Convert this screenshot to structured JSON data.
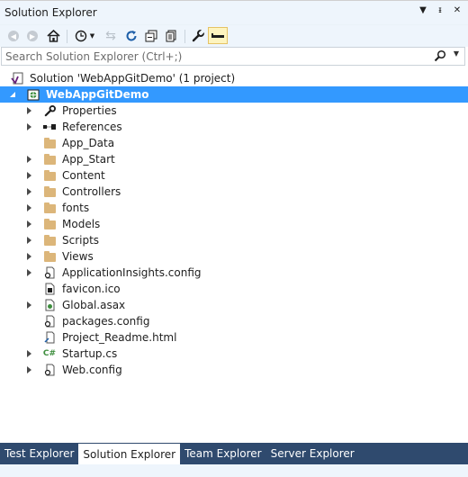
{
  "window": {
    "title": "Solution Explorer",
    "dropdown_icon": "chevron-down-icon",
    "pin_icon": "pin-icon",
    "close_icon": "close-icon"
  },
  "toolbar": {
    "buttons": [
      "back",
      "forward",
      "home",
      "pending-changes",
      "sync",
      "refresh",
      "collapse-all",
      "show-all-files",
      "properties",
      "preview"
    ]
  },
  "search": {
    "placeholder": "Search Solution Explorer (Ctrl+;)"
  },
  "tree": {
    "solution": "Solution 'WebAppGitDemo' (1 project)",
    "project": "WebAppGitDemo",
    "items": [
      {
        "label": "Properties",
        "icon": "wrench-icon",
        "expandable": true
      },
      {
        "label": "References",
        "icon": "references-icon",
        "expandable": true
      },
      {
        "label": "App_Data",
        "icon": "folder-icon",
        "expandable": false
      },
      {
        "label": "App_Start",
        "icon": "folder-icon",
        "expandable": true
      },
      {
        "label": "Content",
        "icon": "folder-icon",
        "expandable": true
      },
      {
        "label": "Controllers",
        "icon": "folder-icon",
        "expandable": true
      },
      {
        "label": "fonts",
        "icon": "folder-icon",
        "expandable": true
      },
      {
        "label": "Models",
        "icon": "folder-icon",
        "expandable": true
      },
      {
        "label": "Scripts",
        "icon": "folder-icon",
        "expandable": true
      },
      {
        "label": "Views",
        "icon": "folder-icon",
        "expandable": true
      },
      {
        "label": "ApplicationInsights.config",
        "icon": "config-file-icon",
        "expandable": true
      },
      {
        "label": "favicon.ico",
        "icon": "image-file-icon",
        "expandable": false
      },
      {
        "label": "Global.asax",
        "icon": "asax-file-icon",
        "expandable": true
      },
      {
        "label": "packages.config",
        "icon": "config-file-icon",
        "expandable": false
      },
      {
        "label": "Project_Readme.html",
        "icon": "html-file-icon",
        "expandable": false
      },
      {
        "label": "Startup.cs",
        "icon": "csharp-file-icon",
        "expandable": true
      },
      {
        "label": "Web.config",
        "icon": "config-file-icon",
        "expandable": true
      }
    ]
  },
  "bottom_tabs": {
    "test": "Test Explorer",
    "solution": "Solution Explorer",
    "team": "Team Explorer",
    "server": "Server Explorer"
  }
}
